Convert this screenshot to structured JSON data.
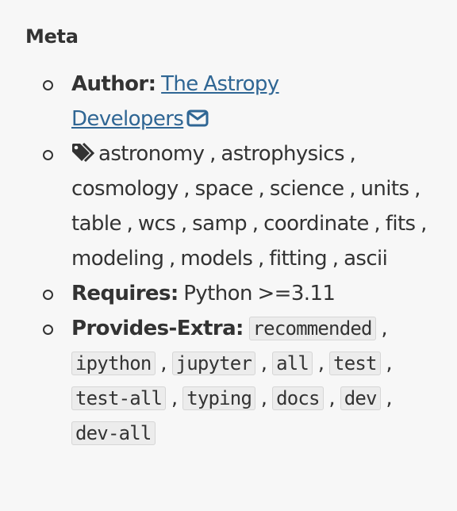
{
  "meta": {
    "heading": "Meta",
    "author": {
      "label": "Author:",
      "name_line1": "The Astropy",
      "name_line2": "Developers",
      "mail_icon": "envelope-icon"
    },
    "keywords": {
      "icon": "tags-icon",
      "items": [
        "astronomy",
        "astrophysics",
        "cosmology",
        "space",
        "science",
        "units",
        "table",
        "wcs",
        "samp",
        "coordinate",
        "fits",
        "modeling",
        "models",
        "fitting",
        "ascii"
      ]
    },
    "requires": {
      "label": "Requires:",
      "value": "Python >=3.11"
    },
    "provides_extra": {
      "label": "Provides-Extra:",
      "items": [
        "recommended",
        "ipython",
        "jupyter",
        "all",
        "test",
        "test-all",
        "typing",
        "docs",
        "dev",
        "dev-all"
      ]
    }
  }
}
